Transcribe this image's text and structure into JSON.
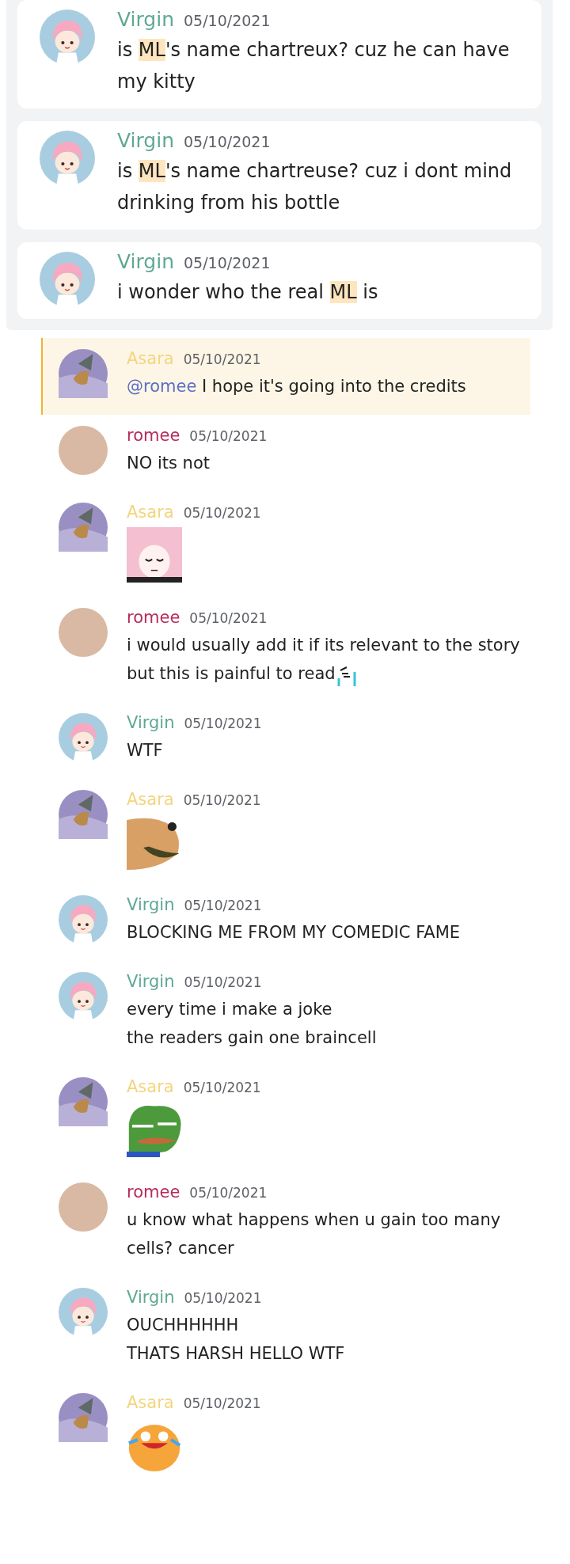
{
  "search_results": [
    {
      "author": "Virgin",
      "color": "#5ea894",
      "timestamp": "05/10/2021",
      "content": [
        {
          "kind": "text",
          "segments": [
            {
              "text": "is "
            },
            {
              "text": "ML",
              "kind": "highlight"
            },
            {
              "text": "'s name chartreux? cuz he can have my kitty"
            }
          ]
        }
      ]
    },
    {
      "author": "Virgin",
      "color": "#5ea894",
      "timestamp": "05/10/2021",
      "content": [
        {
          "kind": "text",
          "segments": [
            {
              "text": "is "
            },
            {
              "text": "ML",
              "kind": "highlight"
            },
            {
              "text": "'s name chartreuse? cuz i dont mind drinking from his bottle"
            }
          ]
        }
      ]
    },
    {
      "author": "Virgin",
      "color": "#5ea894",
      "timestamp": "05/10/2021",
      "content": [
        {
          "kind": "text",
          "segments": [
            {
              "text": "i wonder who the real "
            },
            {
              "text": "ML",
              "kind": "highlight"
            },
            {
              "text": " is"
            }
          ]
        }
      ]
    }
  ],
  "messages": [
    {
      "author": "Asara",
      "color": "#f3d57e",
      "timestamp": "05/10/2021",
      "mentioned": true,
      "content": [
        {
          "kind": "text",
          "segments": [
            {
              "text": "@romee",
              "kind": "mention"
            },
            {
              "text": " I hope it's going into the credits"
            }
          ]
        }
      ]
    },
    {
      "author": "romee",
      "color": "#b72a5c",
      "timestamp": "05/10/2021",
      "mentioned": false,
      "content": [
        {
          "kind": "text",
          "segments": [
            {
              "text": "NO its not"
            }
          ]
        }
      ]
    },
    {
      "author": "Asara",
      "color": "#f3d57e",
      "timestamp": "05/10/2021",
      "mentioned": false,
      "content": [
        {
          "kind": "sticker"
        }
      ]
    },
    {
      "author": "romee",
      "color": "#b72a5c",
      "timestamp": "05/10/2021",
      "mentioned": false,
      "content": [
        {
          "kind": "text",
          "segments": [
            {
              "text": "i would usually add it if its relevant to the story"
            }
          ]
        },
        {
          "kind": "text",
          "segments": [
            {
              "text": "but this is painful to read"
            }
          ]
        }
      ]
    },
    {
      "author": "Virgin",
      "color": "#5ea894",
      "timestamp": "05/10/2021",
      "mentioned": false,
      "content": [
        {
          "kind": "text",
          "segments": [
            {
              "text": "WTF"
            }
          ]
        }
      ]
    },
    {
      "author": "Asara",
      "color": "#f3d57e",
      "timestamp": "05/10/2021",
      "mentioned": false,
      "content": [
        {
          "kind": "sticker"
        }
      ]
    },
    {
      "author": "Virgin",
      "color": "#5ea894",
      "timestamp": "05/10/2021",
      "mentioned": false,
      "content": [
        {
          "kind": "text",
          "segments": [
            {
              "text": "BLOCKING ME FROM MY COMEDIC FAME"
            }
          ]
        }
      ]
    },
    {
      "author": "Virgin",
      "color": "#5ea894",
      "timestamp": "05/10/2021",
      "mentioned": false,
      "content": [
        {
          "kind": "text",
          "segments": [
            {
              "text": "every time i make a joke"
            }
          ]
        },
        {
          "kind": "text",
          "segments": [
            {
              "text": "the readers gain one braincell"
            }
          ]
        }
      ]
    },
    {
      "author": "Asara",
      "color": "#f3d57e",
      "timestamp": "05/10/2021",
      "mentioned": false,
      "content": [
        {
          "kind": "sticker"
        }
      ]
    },
    {
      "author": "romee",
      "color": "#b72a5c",
      "timestamp": "05/10/2021",
      "mentioned": false,
      "content": [
        {
          "kind": "text",
          "segments": [
            {
              "text": "u know what happens when u gain too many cells? cancer"
            }
          ]
        }
      ]
    },
    {
      "author": "Virgin",
      "color": "#5ea894",
      "timestamp": "05/10/2021",
      "mentioned": false,
      "content": [
        {
          "kind": "text",
          "segments": [
            {
              "text": "OUCHHHHHH"
            }
          ]
        },
        {
          "kind": "text",
          "segments": [
            {
              "text": "THATS HARSH HELLO WTF"
            }
          ]
        }
      ]
    },
    {
      "author": "Asara",
      "color": "#f3d57e",
      "timestamp": "05/10/2021",
      "mentioned": false,
      "content": [
        {
          "kind": "sticker"
        }
      ]
    }
  ]
}
